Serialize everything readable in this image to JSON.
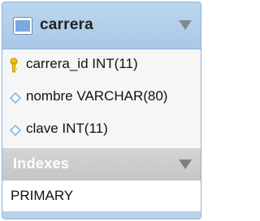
{
  "table": {
    "name": "carrera",
    "columns": [
      {
        "label": "carrera_id INT(11)",
        "icon": "primary-key-icon"
      },
      {
        "label": "nombre VARCHAR(80)",
        "icon": "column-diamond-icon"
      },
      {
        "label": "clave INT(11)",
        "icon": "column-diamond-icon"
      }
    ],
    "indexes_label": "Indexes",
    "indexes": [
      "PRIMARY"
    ]
  },
  "colors": {
    "header": "#a9c8e6",
    "border": "#8bb3db",
    "indexes_header": "#c6c6c6",
    "key": "#f2c40f",
    "diamond": "#7fb8df"
  }
}
